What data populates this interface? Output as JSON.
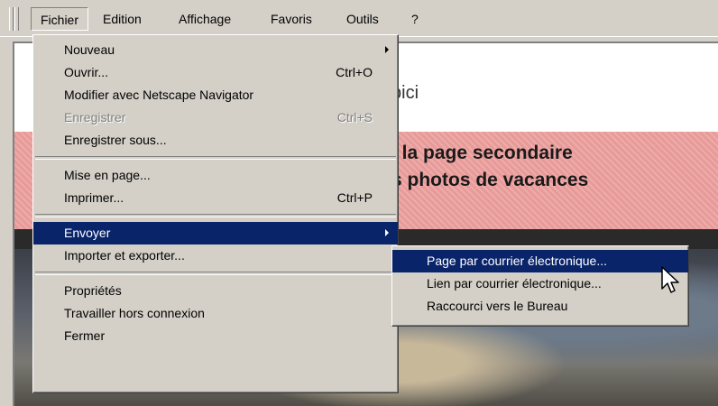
{
  "menubar": {
    "items": [
      "Fichier",
      "Edition",
      "Affichage",
      "Favoris",
      "Outils",
      "?"
    ]
  },
  "page": {
    "heading": "bici",
    "banner_line1": "i la page secondaire",
    "banner_line2": "s photos de vacances"
  },
  "file_menu": {
    "items": [
      {
        "label": "Nouveau",
        "shortcut": "",
        "submenu": true,
        "disabled": false
      },
      {
        "label": "Ouvrir...",
        "shortcut": "Ctrl+O",
        "submenu": false,
        "disabled": false
      },
      {
        "label": "Modifier avec Netscape Navigator",
        "shortcut": "",
        "submenu": false,
        "disabled": false
      },
      {
        "label": "Enregistrer",
        "shortcut": "Ctrl+S",
        "submenu": false,
        "disabled": true
      },
      {
        "label": "Enregistrer sous...",
        "shortcut": "",
        "submenu": false,
        "disabled": false
      },
      {
        "label": "Mise en page...",
        "shortcut": "",
        "submenu": false,
        "disabled": false
      },
      {
        "label": "Imprimer...",
        "shortcut": "Ctrl+P",
        "submenu": false,
        "disabled": false
      },
      {
        "label": "Envoyer",
        "shortcut": "",
        "submenu": true,
        "disabled": false
      },
      {
        "label": "Importer et exporter...",
        "shortcut": "",
        "submenu": false,
        "disabled": false
      },
      {
        "label": "Propriétés",
        "shortcut": "",
        "submenu": false,
        "disabled": false
      },
      {
        "label": "Travailler hors connexion",
        "shortcut": "",
        "submenu": false,
        "disabled": false
      },
      {
        "label": "Fermer",
        "shortcut": "",
        "submenu": false,
        "disabled": false
      }
    ]
  },
  "send_submenu": {
    "items": [
      {
        "label": "Page par courrier électronique..."
      },
      {
        "label": "Lien par courrier électronique..."
      },
      {
        "label": "Raccourci vers le Bureau"
      }
    ]
  },
  "colors": {
    "selection": "#0a246a",
    "face": "#d4d0c8",
    "banner": "#e89a98"
  }
}
